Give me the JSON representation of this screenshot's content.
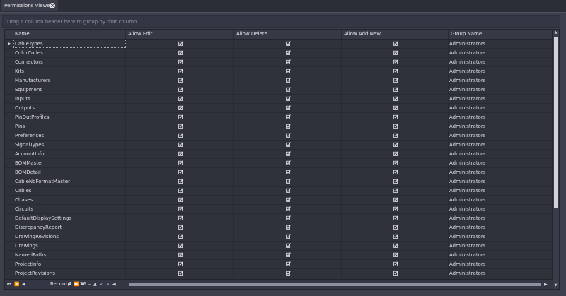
{
  "tab": {
    "title": "Permissions Viewer",
    "close_icon": "close-circle-icon"
  },
  "group_panel": {
    "hint": "Drag a column header here to group by that column"
  },
  "columns": [
    "Name",
    "Allow Edit",
    "Allow Delete",
    "Allow Add New",
    "Group Name"
  ],
  "rows": [
    {
      "name": "CableTypes",
      "group": "Administrators"
    },
    {
      "name": "ColorCodes",
      "group": "Administrators"
    },
    {
      "name": "Connectors",
      "group": "Administrators"
    },
    {
      "name": "Kits",
      "group": "Administrators"
    },
    {
      "name": "Manufacturers",
      "group": "Administrators"
    },
    {
      "name": "Equipment",
      "group": "Administrators"
    },
    {
      "name": "Inputs",
      "group": "Administrators"
    },
    {
      "name": "Outputs",
      "group": "Administrators"
    },
    {
      "name": "PinOutProfiles",
      "group": "Administrators"
    },
    {
      "name": "Pins",
      "group": "Administrators"
    },
    {
      "name": "Preferences",
      "group": "Administrators"
    },
    {
      "name": "SignalTypes",
      "group": "Administrators"
    },
    {
      "name": "AccountInfo",
      "group": "Administrators"
    },
    {
      "name": "BOMMaster",
      "group": "Administrators"
    },
    {
      "name": "BOMDetail",
      "group": "Administrators"
    },
    {
      "name": "CableNoFormatMaster",
      "group": "Administrators"
    },
    {
      "name": "Cables",
      "group": "Administrators"
    },
    {
      "name": "Chases",
      "group": "Administrators"
    },
    {
      "name": "Circuits",
      "group": "Administrators"
    },
    {
      "name": "DefaultDisplaySettings",
      "group": "Administrators"
    },
    {
      "name": "DiscrepancyReport",
      "group": "Administrators"
    },
    {
      "name": "DrawingRevisions",
      "group": "Administrators"
    },
    {
      "name": "Drawings",
      "group": "Administrators"
    },
    {
      "name": "NamedPaths",
      "group": "Administrators"
    },
    {
      "name": "ProjectInfo",
      "group": "Administrators"
    },
    {
      "name": "ProjectRevisions",
      "group": "Administrators"
    }
  ],
  "checked": {
    "allow_edit": true,
    "allow_delete": true,
    "allow_add_new": true
  },
  "navigator": {
    "record_text": "Record 1 of 36"
  },
  "colors": {
    "background": "#2a2c36",
    "panel": "#3c3f4c",
    "grid": "#2f313b",
    "text": "#dcdde3"
  }
}
